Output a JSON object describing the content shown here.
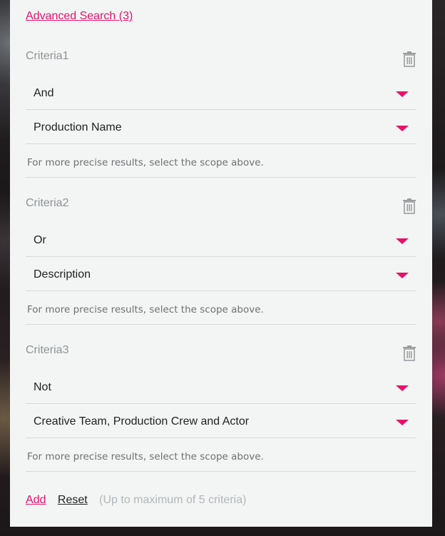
{
  "header": {
    "advanced_search_label": "Advanced Search (3)"
  },
  "criteria": [
    {
      "title": "Criteria1",
      "operator": "And",
      "scope": "Production Name",
      "hint": "For more precise results, select the scope above."
    },
    {
      "title": "Criteria2",
      "operator": "Or",
      "scope": "Description",
      "hint": "For more precise results, select the scope above."
    },
    {
      "title": "Criteria3",
      "operator": "Not",
      "scope": "Creative Team, Production Crew and Actor",
      "hint": "For more precise results, select the scope above."
    }
  ],
  "footer": {
    "add_label": "Add",
    "reset_label": "Reset",
    "note": "(Up to maximum of 5 criteria)"
  },
  "colors": {
    "accent": "#e8126a",
    "panel_bg": "#f3f5f4"
  },
  "icons": {
    "delete": "trash-icon",
    "dropdown": "caret-down-icon"
  }
}
